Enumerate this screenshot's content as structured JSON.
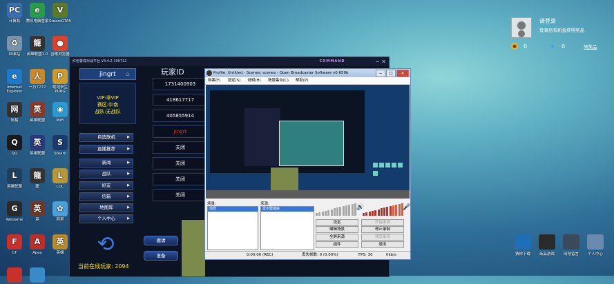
{
  "desktop": {
    "icons": [
      {
        "label": "计算机",
        "glyph": "PC",
        "color": "#3a6fb0"
      },
      {
        "label": "腾讯电脑管家",
        "glyph": "e",
        "color": "#2a9a4c"
      },
      {
        "label": "SteamGTA5",
        "glyph": "V",
        "color": "#587a2a"
      },
      {
        "label": "回收站",
        "glyph": "♻",
        "color": "#7b93a8"
      },
      {
        "label": "英雄联盟1.0",
        "glyph": "龍",
        "color": "#333333"
      },
      {
        "label": "谷歌浏览器",
        "glyph": "●",
        "color": "#d8432f"
      },
      {
        "label": "Internet Explorer",
        "glyph": "e",
        "color": "#1f78c8"
      },
      {
        "label": "一万7777",
        "glyph": "人",
        "color": "#c8892e"
      },
      {
        "label": "绝地求生 PUBG",
        "glyph": "P",
        "color": "#cf9b2e"
      },
      {
        "label": "网易",
        "glyph": "网",
        "color": "#333333"
      },
      {
        "label": "英雄联盟",
        "glyph": "英",
        "color": "#8a3a2a"
      },
      {
        "label": "WiFi",
        "glyph": "◉",
        "color": "#2a9ad0"
      },
      {
        "label": "QQ",
        "glyph": "Q",
        "color": "#1a1a1a"
      },
      {
        "label": "英雄联盟",
        "glyph": "英",
        "color": "#2a3a7a"
      },
      {
        "label": "Steam",
        "glyph": "S",
        "color": "#1a3a6a"
      },
      {
        "label": "英雄联盟",
        "glyph": "L",
        "color": "#1f3f5a"
      },
      {
        "label": "龍",
        "glyph": "龍",
        "color": "#333333"
      },
      {
        "label": "LOL",
        "glyph": "L",
        "color": "#b8963a"
      },
      {
        "label": "WeGame",
        "glyph": "G",
        "color": "#2a2a2a"
      },
      {
        "label": "英",
        "glyph": "英",
        "color": "#6a3a2a"
      },
      {
        "label": "阿里",
        "glyph": "✿",
        "color": "#4aa0d8"
      },
      {
        "label": "CF",
        "glyph": "F",
        "color": "#c8302a"
      },
      {
        "label": "Apex",
        "glyph": "A",
        "color": "#b8302a"
      },
      {
        "label": "英雄",
        "glyph": "英",
        "color": "#b88a2a"
      },
      {
        "label": "",
        "glyph": "",
        "color": "#c8302a"
      },
      {
        "label": "",
        "glyph": "",
        "color": "#3a8ac8"
      }
    ]
  },
  "game": {
    "title": "红色警戒对战平台 V3.4.2.190712",
    "logo": "COMMAND",
    "user_name": "jingrt",
    "vip_line1": "VIP:非VIP",
    "vip_line2": "赛区:中南",
    "vip_line3": "战队:无战队",
    "menu": [
      "自选联机",
      "直播推荐",
      "新闻",
      "战队",
      "好友",
      "信箱",
      "地图库",
      "个人中心"
    ],
    "player_header": "玩家ID",
    "players": [
      "1731400903",
      "418617717",
      "405855914",
      "Jingrt",
      "关闭",
      "关闭",
      "关闭",
      "关闭"
    ],
    "side_buttons": [
      "邀请",
      "准备"
    ],
    "online_label": "当前在线玩家: 2094"
  },
  "obs": {
    "title": "Profile: Untitled - Scenes: scenes - Open Broadcaster Software v0.659b",
    "menu": [
      "档案(F)",
      "设定(S)",
      "说明(H)",
      "场景集合(C)",
      "帮助(P)"
    ],
    "scenes_label": "场景:",
    "sources_label": "来源:",
    "scene_item": "场景",
    "source_item": "显示器捕获",
    "buttons": [
      {
        "label": "设定",
        "disabled": false
      },
      {
        "label": "开始串流",
        "disabled": true
      },
      {
        "label": "编辑场景",
        "disabled": false
      },
      {
        "label": "停止录制",
        "disabled": false
      },
      {
        "label": "全屏来源",
        "disabled": false
      },
      {
        "label": "预览串流",
        "disabled": true
      },
      {
        "label": "插件",
        "disabled": false
      },
      {
        "label": "退出",
        "disabled": false
      }
    ],
    "status": {
      "time": "0:00:00 (REC)",
      "frames": "丢失帧数: 0 (0.00%)",
      "fps": "FPS: 30",
      "bitrate": "0kb/s"
    }
  },
  "right_panel": {
    "login": "请登录",
    "login_sub": "登录后有机会获得奖品",
    "coin_value": "0",
    "diamond_value": "0",
    "recharge": "领奖品",
    "tiles": [
      {
        "label": "猜你下载",
        "color": "#1f6fb8"
      },
      {
        "label": "商品游戏",
        "color": "#2a2a2a"
      },
      {
        "label": "网吧留言",
        "color": "#3a4a5a"
      },
      {
        "label": "个人中心",
        "color": "#6a8ab0"
      }
    ]
  }
}
